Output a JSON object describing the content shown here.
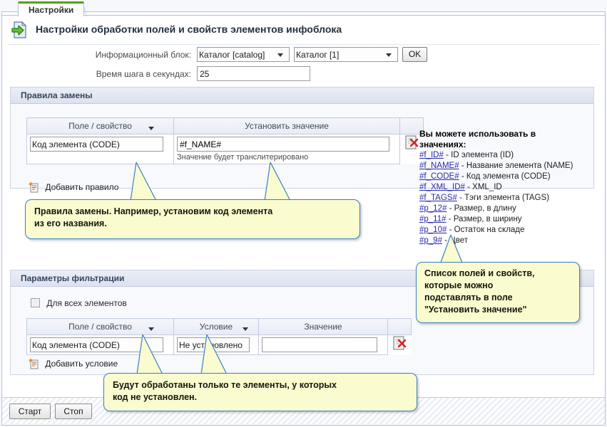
{
  "window": {
    "tab_label": "Настройки",
    "page_title": "Настройки обработки полей и свойств элементов инфоблока",
    "header_icon": "document-import-icon"
  },
  "form": {
    "infoblock_label": "Информационный блок:",
    "infoblock_type_value": "Каталог [catalog]",
    "infoblock_value": "Каталог [1]",
    "ok_button": "OK",
    "step_label": "Время шага в секундах:",
    "step_value": "25"
  },
  "replace_section": {
    "title": "Правила замены",
    "columns": [
      "Поле / свойство",
      "Установить значение"
    ],
    "row": {
      "field_value": "Код элемента (CODE)",
      "set_value": "#f_NAME#",
      "hint": "Значение будет транслитерировано",
      "delete_icon": "delete-document-icon"
    },
    "add_link": "Добавить правило",
    "add_icon": "add-rule-icon"
  },
  "filter_section": {
    "title": "Параметры фильтрации",
    "checkbox_label": "Для всех элементов",
    "checkbox_checked": false,
    "columns": [
      "Поле / свойство",
      "Условие",
      "Значение"
    ],
    "row": {
      "field_value": "Код элемента (CODE)",
      "condition_value": "Не установлено",
      "value_text": "",
      "delete_icon": "delete-document-icon"
    },
    "add_link": "Добавить условие",
    "add_icon": "add-condition-icon"
  },
  "help_panel": {
    "title_line1": "Вы можете использовать в",
    "title_line2": "значениях:",
    "items": [
      {
        "code": "#f_ID#",
        "desc": "- ID элемента (ID)"
      },
      {
        "code": "#f_NAME#",
        "desc": "- Название элемента (NAME)"
      },
      {
        "code": "#f_CODE#",
        "desc": "- Код элемента (CODE)"
      },
      {
        "code": "#f_XML_ID#",
        "desc": "- XML_ID"
      },
      {
        "code": "#f_TAGS#",
        "desc": "- Тэги элемента (TAGS)"
      },
      {
        "code": "#p_12#",
        "desc": "- Размер, в длину"
      },
      {
        "code": "#p_11#",
        "desc": "- Размер, в ширину"
      },
      {
        "code": "#p_10#",
        "desc": "- Остаток на складе"
      },
      {
        "code": "#p_9#",
        "desc": "- Цвет"
      }
    ]
  },
  "callouts": {
    "replace": {
      "line1": "Правила замены. Например, установим код элемента",
      "line2": "из его названия."
    },
    "help": {
      "line1": "Список полей и свойств,",
      "line2": "которые можно",
      "line3": "подставлять в поле",
      "line4": "\"Установить значение\""
    },
    "filter": {
      "line1": "Будут обработаны только те элементы, у которых",
      "line2": "код не установлен."
    }
  },
  "footer": {
    "start_button": "Старт",
    "stop_button": "Стоп"
  },
  "colors": {
    "tab_accent": "#52a400",
    "callout_bg": "#fbfbd0",
    "callout_border": "#3a7fc1",
    "link": "#2a2aaa",
    "section_header_bg": "#e4e9f4"
  }
}
